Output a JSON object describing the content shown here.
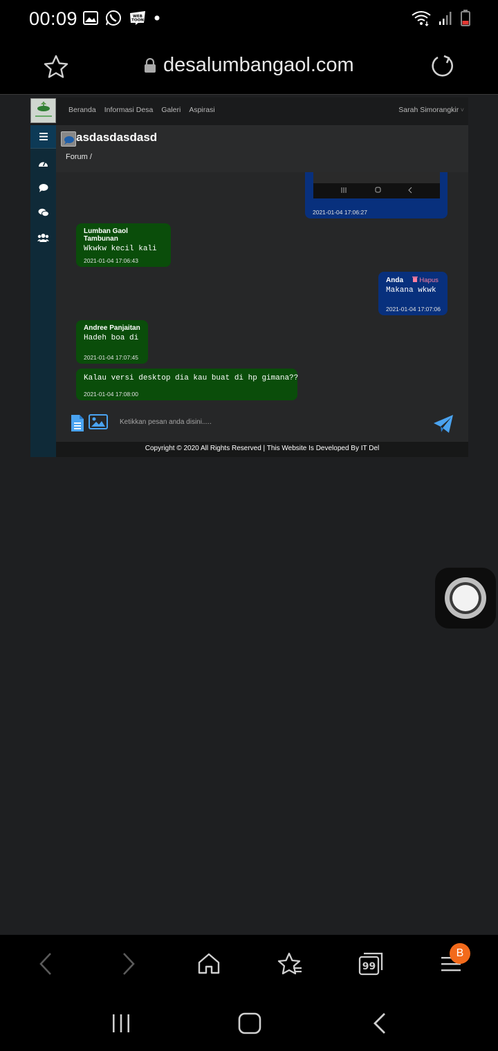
{
  "status_bar": {
    "time": "00:09"
  },
  "browser": {
    "url": "desalumbangaol.com"
  },
  "site": {
    "nav_links": [
      "Beranda",
      "Informasi Desa",
      "Galeri",
      "Aspirasi"
    ],
    "user": "Sarah Simorangkir"
  },
  "forum": {
    "title": "asdasdasdasd",
    "breadcrumb": "Forum /"
  },
  "messages": [
    {
      "direction": "out",
      "sender": "",
      "text": "",
      "time": "2021-01-04 17:06:27"
    },
    {
      "direction": "in",
      "sender": "Lumban Gaol Tambunan",
      "text": "Wkwkw kecil kali",
      "time": "2021-01-04 17:06:43"
    },
    {
      "direction": "out",
      "sender": "Anda",
      "delete_label": "Hapus",
      "text": "Makana wkwk",
      "time": "2021-01-04 17:07:06"
    },
    {
      "direction": "in",
      "sender": "Andree Panjaitan",
      "text": "Hadeh boa di",
      "time": "2021-01-04 17:07:45"
    },
    {
      "direction": "in",
      "sender": "",
      "text": "Kalau versi desktop dia kau buat di hp gimana??",
      "time": "2021-01-04 17:08:00"
    }
  ],
  "composer": {
    "placeholder": "Ketikkan pesan anda disini....."
  },
  "footer": {
    "text": "Copyright © 2020 All Rights Reserved | This Website Is Developed By IT Del"
  },
  "browser_bottom": {
    "tab_count": "99",
    "badge": "B"
  },
  "colors": {
    "incoming": "#0a4d0a",
    "outgoing": "#08307d",
    "accent": "#4aa3f0"
  }
}
